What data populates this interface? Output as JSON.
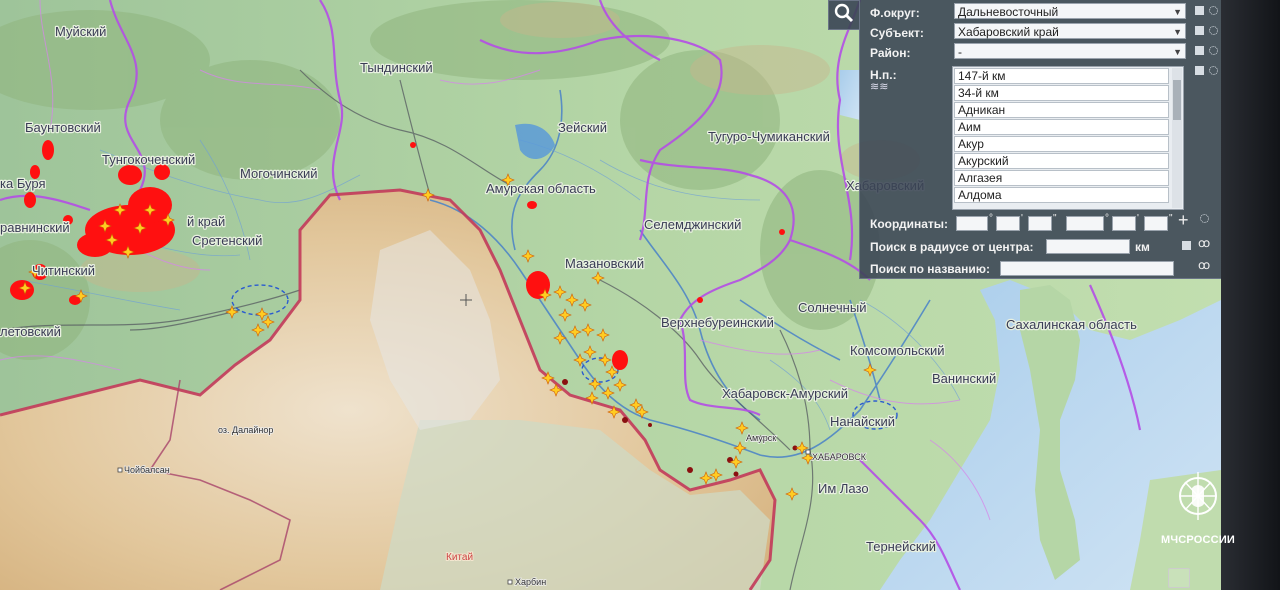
{
  "panel": {
    "district_label": "Ф.округ:",
    "district_value": "Дальневосточный",
    "subject_label": "Субъект:",
    "subject_value": "Хабаровский край",
    "area_label": "Район:",
    "area_value": "-",
    "settlement_label": "Н.п.:",
    "settlements": [
      "147-й км",
      "34-й км",
      "Адникан",
      "Аим",
      "Акур",
      "Акурский",
      "Алгазея",
      "Алдома"
    ],
    "coords_label": "Координаты:",
    "radius_label": "Поиск в радиусе от центра:",
    "radius_unit": "км",
    "name_search_label": "Поиск по названию:"
  },
  "map_labels": {
    "muisky": "Муйский",
    "bauntovsky": "Баунтовский",
    "tungokochensky": "Тунгокоченский",
    "respublika_buryatia": "ка Буря",
    "mogochinsky": "Могочинский",
    "zabaikalsky_krai": "й край",
    "sretensky": "Сретенский",
    "pravninsky": "равнинский",
    "chitinsky": "Читинский",
    "letovsky": "летовский",
    "tyndinsky": "Тындинский",
    "zeysky": "Зейский",
    "amurskaya": "Амурская область",
    "tuguro": "Тугуро-Чумиканский",
    "khabarovsky": "Хабаровский",
    "selemdzhinsky": "Селемджинский",
    "mazanovsky": "Мазановский",
    "verkhnebureinsky": "Верхнебуреинский",
    "solnechny": "Солнечный",
    "sakhalinskaya": "Сахалинская область",
    "komsomolsky": "Комсомольский",
    "vaninsky": "Ванинский",
    "khabarovsk_amursky": "Хабаровск-Амурский",
    "nanaisky": "Нанайский",
    "im_lazo": "Им Лазо",
    "terneysky": "Тернейский",
    "kitai": "Китай",
    "khabarovsk_city": "ХАБАРОВСК",
    "harbin": "Харбин",
    "choibalsan": "Чойбалсан",
    "mongolia_lake": "оз. Далайнор",
    "amursk": "Амурск"
  },
  "colors": {
    "fire": "#ff1010",
    "star": "#ffcc22",
    "border_country": "#c23a5a",
    "border_region": "#b050e0",
    "panel_bg": "#3a4454"
  },
  "logo": {
    "text": "МЧСРОССИИ"
  },
  "icons": [
    "search-icon",
    "layers-icon",
    "add-icon",
    "target-icon",
    "binoculars-icon",
    "fullscreen-icon",
    "emercom-logo"
  ]
}
